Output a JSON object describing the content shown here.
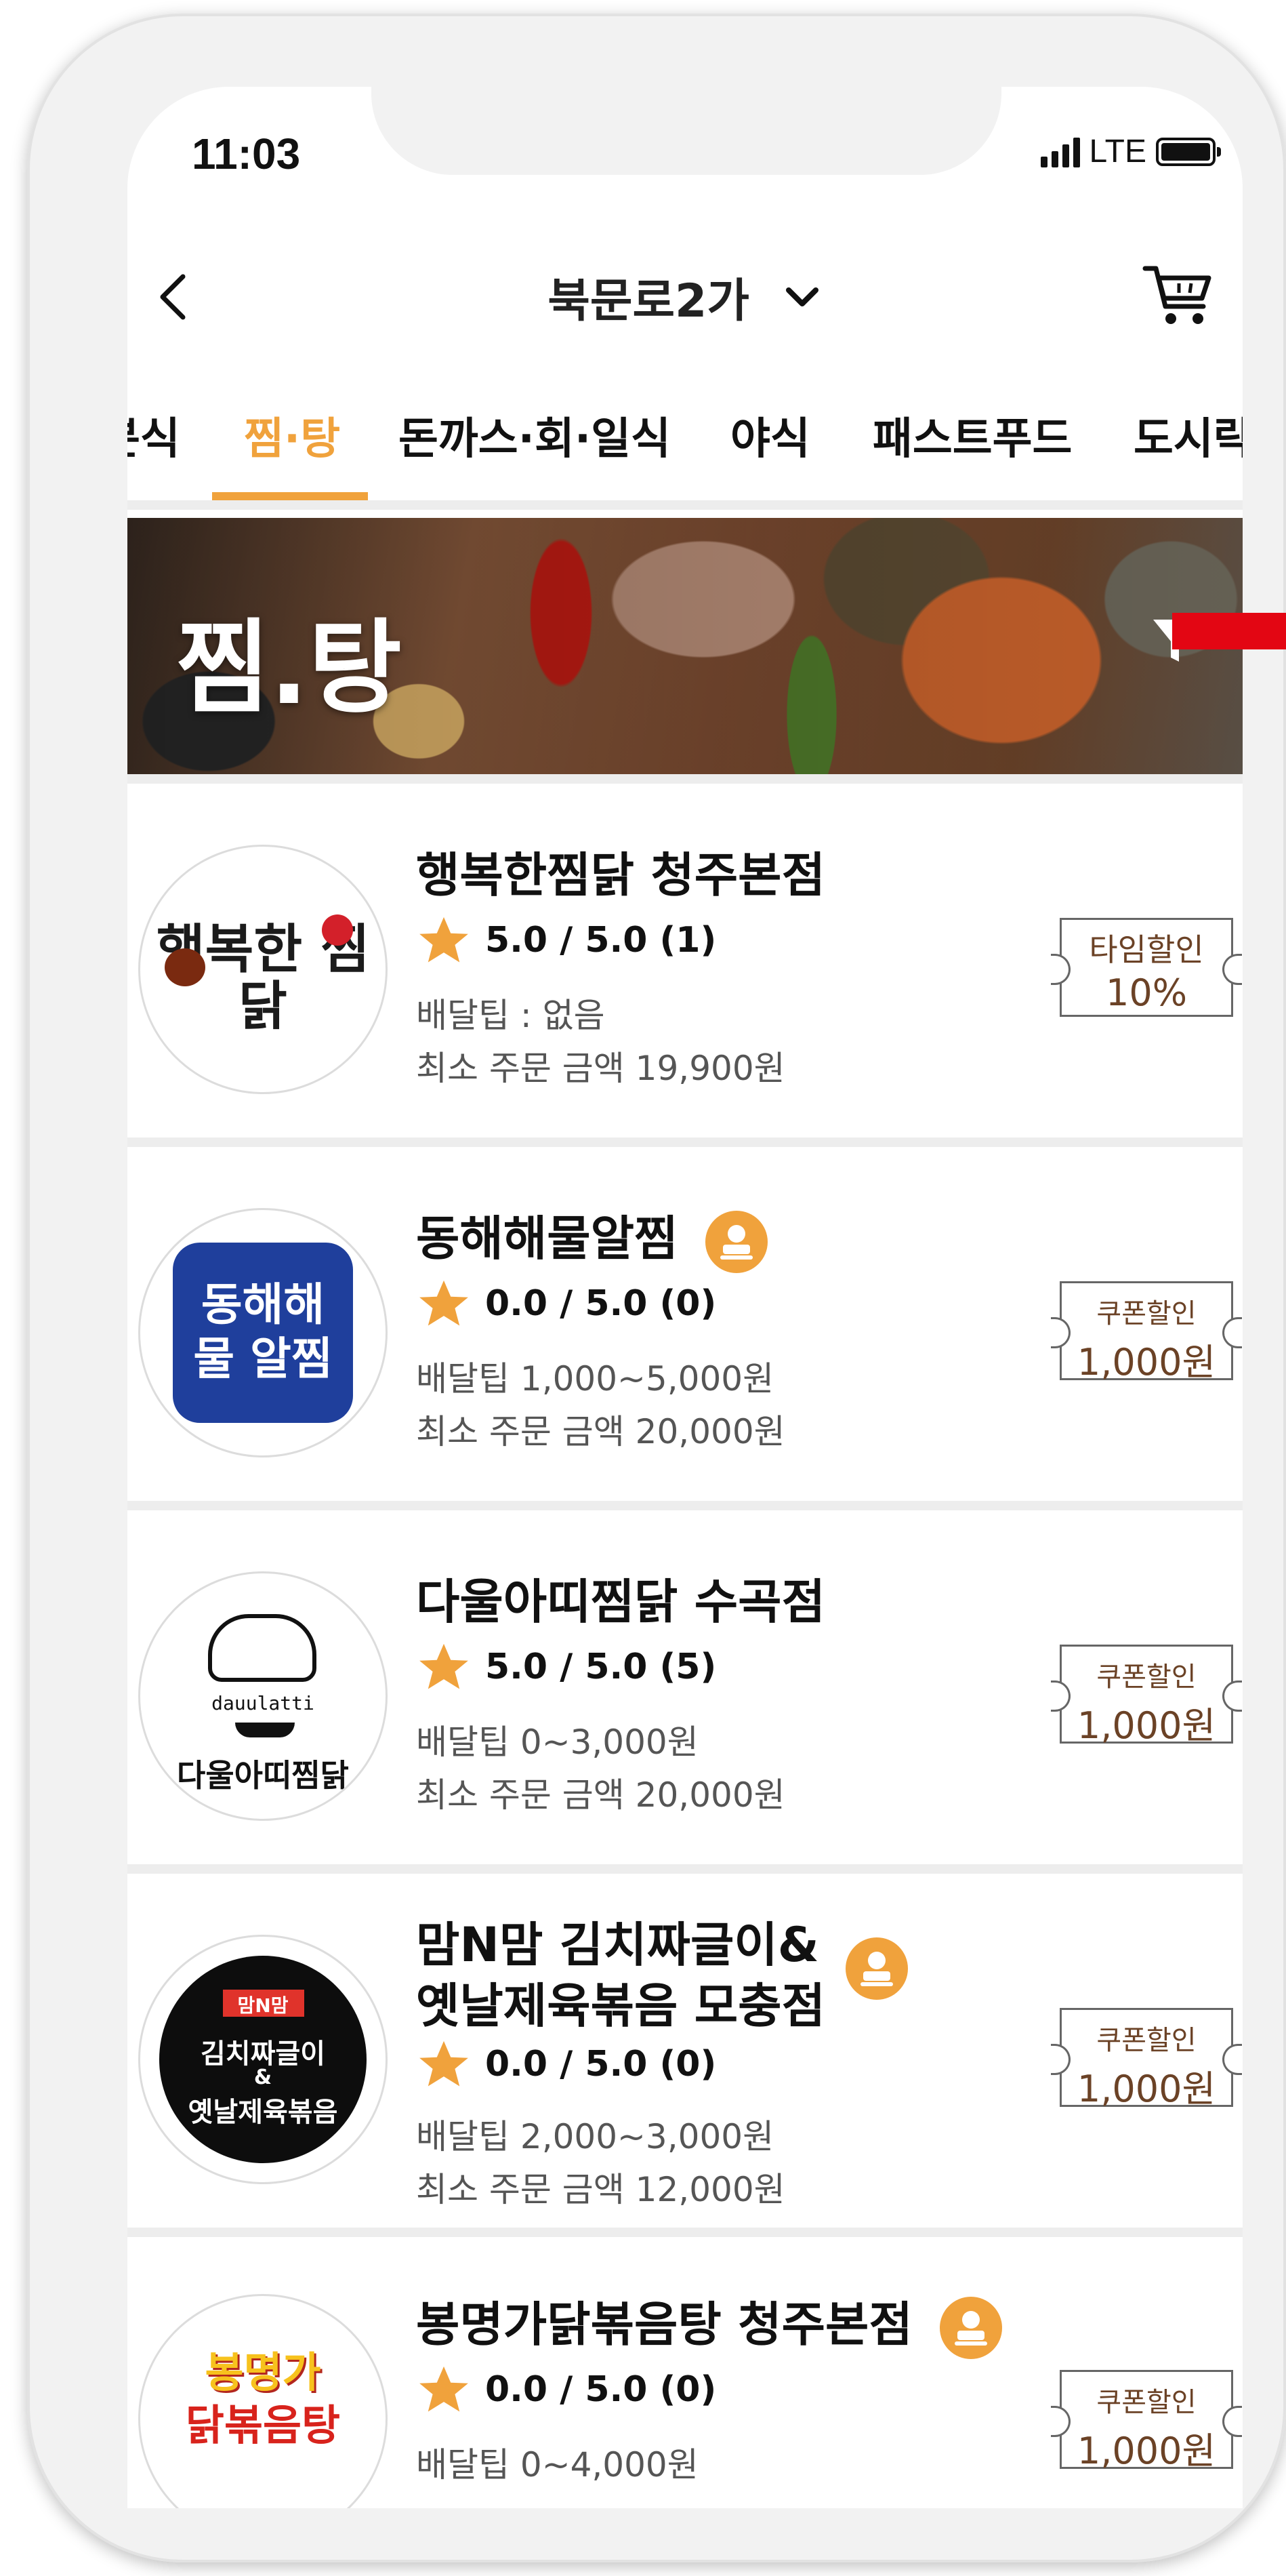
{
  "status_bar": {
    "time": "11:03",
    "network": "LTE"
  },
  "header": {
    "location": "북문로2가"
  },
  "category_tabs": [
    "분식",
    "찜·탕",
    "돈까스·회·일식",
    "야식",
    "패스트푸드",
    "도시락"
  ],
  "active_tab_index": 1,
  "banner": {
    "title": "찜.탕"
  },
  "restaurants": [
    {
      "name": "행복한찜닭 청주본점",
      "logo_text": "행복한 찜닭",
      "rating": "5.0 / 5.0 (1)",
      "delivery_tip": "배달팁 : 없음",
      "min_order": "최소 주문 금액 19,900원",
      "discount_label": "타임할인",
      "discount_value": "10%",
      "owner_badge": false
    },
    {
      "name": "동해해물알찜",
      "logo_text": "동해해물 알찜",
      "rating": "0.0 / 5.0 (0)",
      "delivery_tip": "배달팁 1,000~5,000원",
      "min_order": "최소 주문 금액 20,000원",
      "discount_label": "쿠폰할인",
      "discount_value": "1,000원",
      "owner_badge": true
    },
    {
      "name": "다울아띠찜닭 수곡점",
      "logo_text": "다울아띠찜닭",
      "logo_sub": "dauulatti",
      "rating": "5.0 / 5.0 (5)",
      "delivery_tip": "배달팁 0~3,000원",
      "min_order": "최소 주문 금액 20,000원",
      "discount_label": "쿠폰할인",
      "discount_value": "1,000원",
      "owner_badge": false
    },
    {
      "name_line1": "맘N맘 김치짜글이&",
      "name_line2": "옛날제육볶음 모충점",
      "logo_tag": "맘N맘",
      "logo_line1": "김치짜글이",
      "logo_line2": "&",
      "logo_line3": "옛날제육볶음",
      "rating": "0.0 / 5.0 (0)",
      "delivery_tip": "배달팁 2,000~3,000원",
      "min_order": "최소 주문 금액 12,000원",
      "discount_label": "쿠폰할인",
      "discount_value": "1,000원",
      "owner_badge": true
    },
    {
      "name": "봉명가닭볶음탕 청주본점",
      "logo_line1": "봉명가",
      "logo_line2": "닭볶음탕",
      "rating": "0.0 / 5.0 (0)",
      "delivery_tip": "배달팁 0~4,000원",
      "discount_label": "쿠폰할인",
      "discount_value": "1,000원",
      "owner_badge": true
    }
  ],
  "colors": {
    "accent": "#f0a23c",
    "star": "#f0a23c",
    "coupon_text": "#6b4226",
    "marker": "#e30613"
  },
  "icons": [
    "back-icon",
    "chevron-down-icon",
    "cart-icon",
    "filter-icon",
    "star-icon",
    "owner-badge-icon"
  ]
}
